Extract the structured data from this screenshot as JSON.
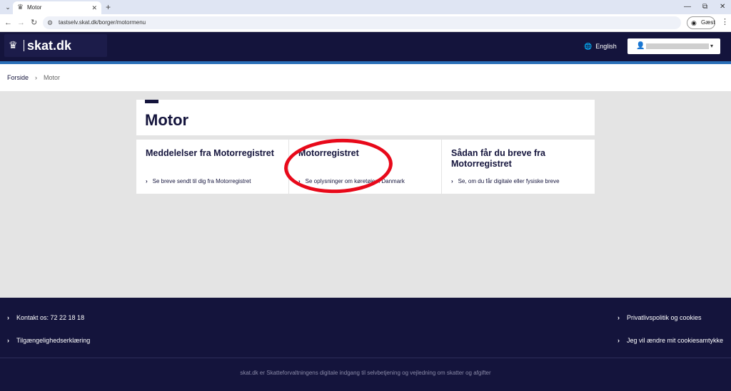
{
  "browser": {
    "tab_dropdown_glyph": "⌄",
    "tab_favicon": "♛",
    "tab_title": "Motor",
    "tab_close": "✕",
    "new_tab": "+",
    "win_minimize": "—",
    "win_restore": "⧉",
    "win_close": "✕",
    "back": "←",
    "forward": "→",
    "reload": "↻",
    "site_info_icon": "⚙",
    "url": "tastselv.skat.dk/borger/motormenu",
    "guest_icon": "◉",
    "guest_label": "Gæst",
    "menu_glyph": "⋮"
  },
  "header": {
    "logo_crown": "♛",
    "logo_text": "skat.dk",
    "language_icon": "🌐",
    "language_label": "English",
    "user_icon": "👤",
    "user_caret": "▾"
  },
  "breadcrumb": {
    "home": "Forside",
    "separator": "›",
    "current": "Motor"
  },
  "page": {
    "title": "Motor"
  },
  "cards": [
    {
      "title": "Meddelelser fra Motorregistret",
      "link": "Se breve sendt til dig fra Motorregistret"
    },
    {
      "title": "Motorregistret",
      "link": "Se oplysninger om køretøjer i Danmark"
    },
    {
      "title": "Sådan får du breve fra Motorregistret",
      "link": "Se, om du får digitale eller fysiske breve"
    }
  ],
  "chevron": "›",
  "footer": {
    "contact": "Kontakt os: 72 22 18 18",
    "accessibility": "Tilgængelighedserklæring",
    "privacy": "Privatlivspolitik og cookies",
    "cookie_consent": "Jeg vil ændre mit cookiesamtykke",
    "tagline": "skat.dk er Skatteforvaltningens digitale indgang til selvbetjening og vejledning om skatter og afgifter"
  },
  "colors": {
    "brand_navy": "#14143c",
    "accent_blue": "#2a6fb8",
    "annotation_red": "#e8091a"
  }
}
